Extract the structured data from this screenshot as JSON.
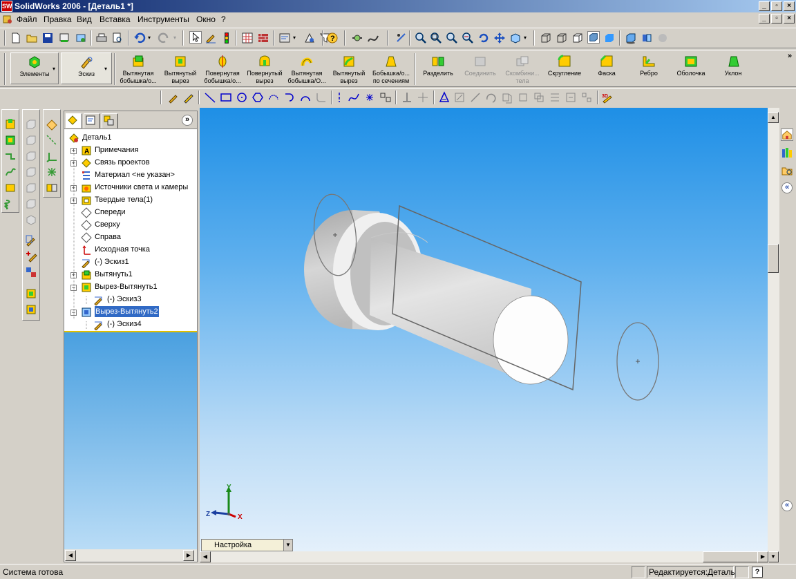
{
  "window": {
    "title": "SolidWorks 2006 - [Деталь1 *]",
    "logo_text": "SW"
  },
  "menu": [
    {
      "label": "Файл"
    },
    {
      "label": "Правка"
    },
    {
      "label": "Вид"
    },
    {
      "label": "Вставка"
    },
    {
      "label": "Инструменты"
    },
    {
      "label": "Окно"
    },
    {
      "label": "?"
    }
  ],
  "command_manager": {
    "groups": [
      {
        "label": "Элементы"
      },
      {
        "label": "Эскиз"
      }
    ],
    "buttons": [
      {
        "label": "Вытянутая\nбобышка/о..."
      },
      {
        "label": "Вытянутый\nвырез"
      },
      {
        "label": "Повернутая\nбобышка/о..."
      },
      {
        "label": "Повернутый\nвырез"
      },
      {
        "label": "Вытянутая\nбобышка/О..."
      },
      {
        "label": "Вытянутый\nвырез"
      },
      {
        "label": "Бобышка/о...\nпо сечениям"
      },
      {
        "label": "Разделить"
      },
      {
        "label": "Соединить"
      },
      {
        "label": "Скомбини...\nтела"
      },
      {
        "label": "Скругление"
      },
      {
        "label": "Фаска"
      },
      {
        "label": "Ребро"
      },
      {
        "label": "Оболочка"
      },
      {
        "label": "Уклон"
      }
    ],
    "more": "»"
  },
  "feature_tree": {
    "items": [
      {
        "label": "Деталь1"
      },
      {
        "label": "Примечания"
      },
      {
        "label": "Связь проектов"
      },
      {
        "label": "Материал <не указан>"
      },
      {
        "label": "Источники света и камеры"
      },
      {
        "label": "Твердые тела(1)"
      },
      {
        "label": "Спереди"
      },
      {
        "label": "Сверху"
      },
      {
        "label": "Справа"
      },
      {
        "label": "Исходная точка"
      },
      {
        "label": "(-) Эскиз1"
      },
      {
        "label": "Вытянуть1"
      },
      {
        "label": "Вырез-Вытянуть1"
      },
      {
        "label": "(-) Эскиз3"
      },
      {
        "label": "Вырез-Вытянуть2"
      },
      {
        "label": "(-) Эскиз4"
      }
    ],
    "expand_plus": "+",
    "expand_minus": "−",
    "collapse_glyph": "»"
  },
  "viewport": {
    "triad": {
      "x": "X",
      "y": "Y",
      "z": "Z"
    },
    "config_label": "Настройка"
  },
  "status": {
    "left": "Система готова",
    "mode": "Редактируется:Деталь",
    "help": "?"
  },
  "colors": {
    "title_start": "#0a246a",
    "title_end": "#a6caf0",
    "selection": "#316ac5",
    "viewport_top": "#1e8fe6",
    "viewport_bottom": "#e4f0fb",
    "part_body": "#d8d8d8"
  }
}
